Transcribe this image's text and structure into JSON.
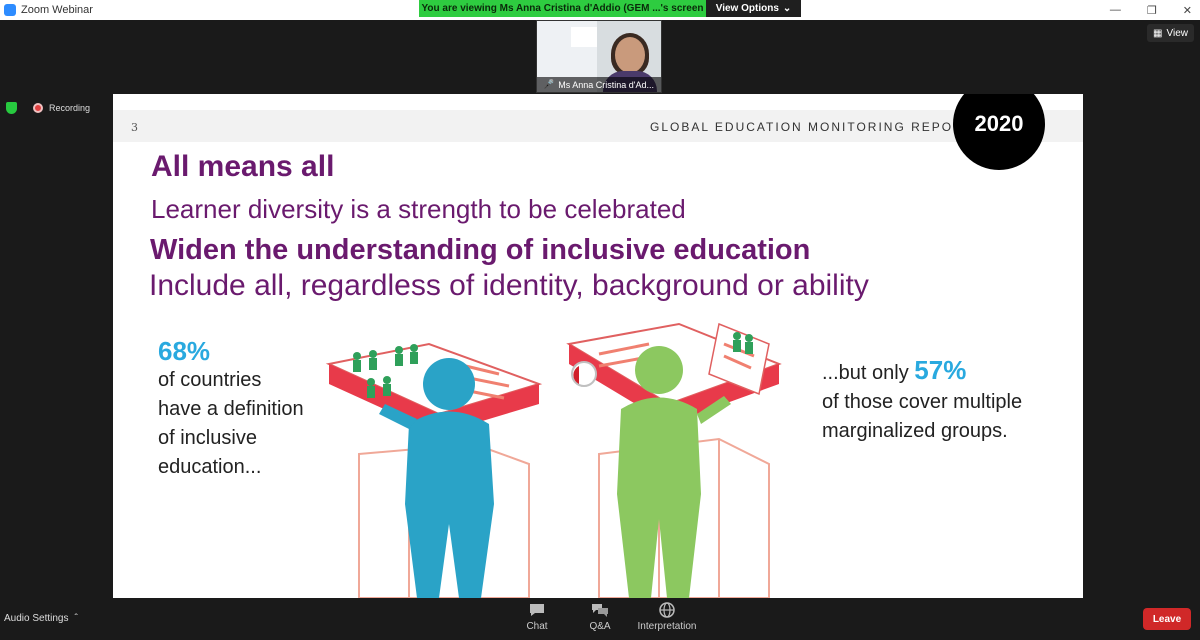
{
  "window": {
    "title": "Zoom Webinar"
  },
  "share_banner": {
    "message": "You are viewing Ms Anna Cristina d'Addio (GEM ...'s screen",
    "view_options": "View Options"
  },
  "video_thumb": {
    "name": "Ms Anna Cristina d'Ad..."
  },
  "view_button": "View",
  "status": {
    "recording": "Recording"
  },
  "slide": {
    "number": "3",
    "report_title": "GLOBAL EDUCATION MONITORING REPORT",
    "year": "2020",
    "heading1": "All means all",
    "heading2": "Learner diversity is a strength to be celebrated",
    "heading3": "Widen the understanding of inclusive education",
    "heading4": "Include all, regardless of identity, background or ability",
    "stat_left": {
      "percent": "68%",
      "line1": "of countries",
      "line2": "have a definition",
      "line3": "of inclusive",
      "line4": "education..."
    },
    "stat_right": {
      "prefix": "...but only",
      "percent": "57%",
      "line1": "of those cover multiple",
      "line2": "marginalized groups."
    }
  },
  "toolbar": {
    "audio_settings": "Audio Settings",
    "chat": "Chat",
    "qa": "Q&A",
    "interpretation": "Interpretation",
    "leave": "Leave"
  },
  "colors": {
    "purple": "#6a1a6e",
    "cyan": "#29a9df",
    "leave": "#d02828",
    "banner": "#2ecc40"
  }
}
